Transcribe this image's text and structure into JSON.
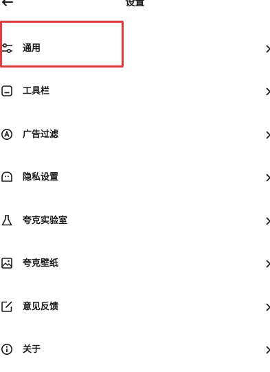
{
  "header": {
    "title": "设置",
    "back_icon": "back-arrow-icon"
  },
  "settings": {
    "items": [
      {
        "label": "通用",
        "icon": "sliders-icon"
      },
      {
        "label": "工具栏",
        "icon": "toolbar-icon"
      },
      {
        "label": "广告过滤",
        "icon": "ad-filter-icon"
      },
      {
        "label": "隐私设置",
        "icon": "privacy-icon"
      },
      {
        "label": "夸克实验室",
        "icon": "lab-flask-icon"
      },
      {
        "label": "夸克壁纸",
        "icon": "wallpaper-icon"
      },
      {
        "label": "意见反馈",
        "icon": "feedback-edit-icon"
      },
      {
        "label": "关于",
        "icon": "info-icon"
      }
    ]
  },
  "annotation": {
    "highlight_color": "#e23b3b"
  }
}
